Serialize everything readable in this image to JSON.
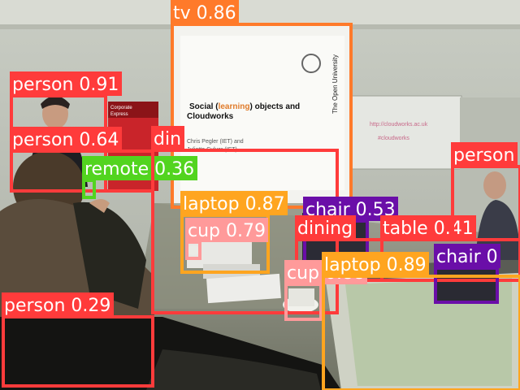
{
  "scene": {
    "slide": {
      "title_pre": "Social (",
      "title_accent": "learning",
      "title_post": ") objects and",
      "title_line2": "Cloudworks",
      "author_line1": "Chris Pegler (IET) and",
      "author_line2": "Juliette Culver (IET)",
      "side_text": "The Open University"
    },
    "poster": {
      "line1": "Corporate",
      "line2": "Express"
    },
    "whiteboard": {
      "line1": "http://cloudworks.ac.uk",
      "line2": "#cloudworks"
    }
  },
  "detections": [
    {
      "label": "tv 0.86",
      "color": "#ff7a2a"
    },
    {
      "label": "person 0.91",
      "color": "#ff3b3b"
    },
    {
      "label": "person 0.64",
      "color": "#ff3b3b"
    },
    {
      "label": "remote 0.36",
      "color": "#52d41f"
    },
    {
      "label": "laptop 0.87",
      "color": "#ffa520"
    },
    {
      "label": "cup 0.79",
      "color": "#ff9a9a"
    },
    {
      "label": "din",
      "color": "#ff3b3b"
    },
    {
      "label": "chair 0.53",
      "color": "#6a0ea8"
    },
    {
      "label": "dining",
      "color": "#ff3b3b"
    },
    {
      "label": "table 0.41",
      "color": "#ff3b3b"
    },
    {
      "label": "person",
      "color": "#ff3b3b"
    },
    {
      "label": "chair 0",
      "color": "#6a0ea8"
    },
    {
      "label": "cup 0.88",
      "color": "#ff9a9a"
    },
    {
      "label": "laptop 0.89",
      "color": "#ffa520"
    },
    {
      "label": "person 0.29",
      "color": "#ff3b3b"
    }
  ]
}
